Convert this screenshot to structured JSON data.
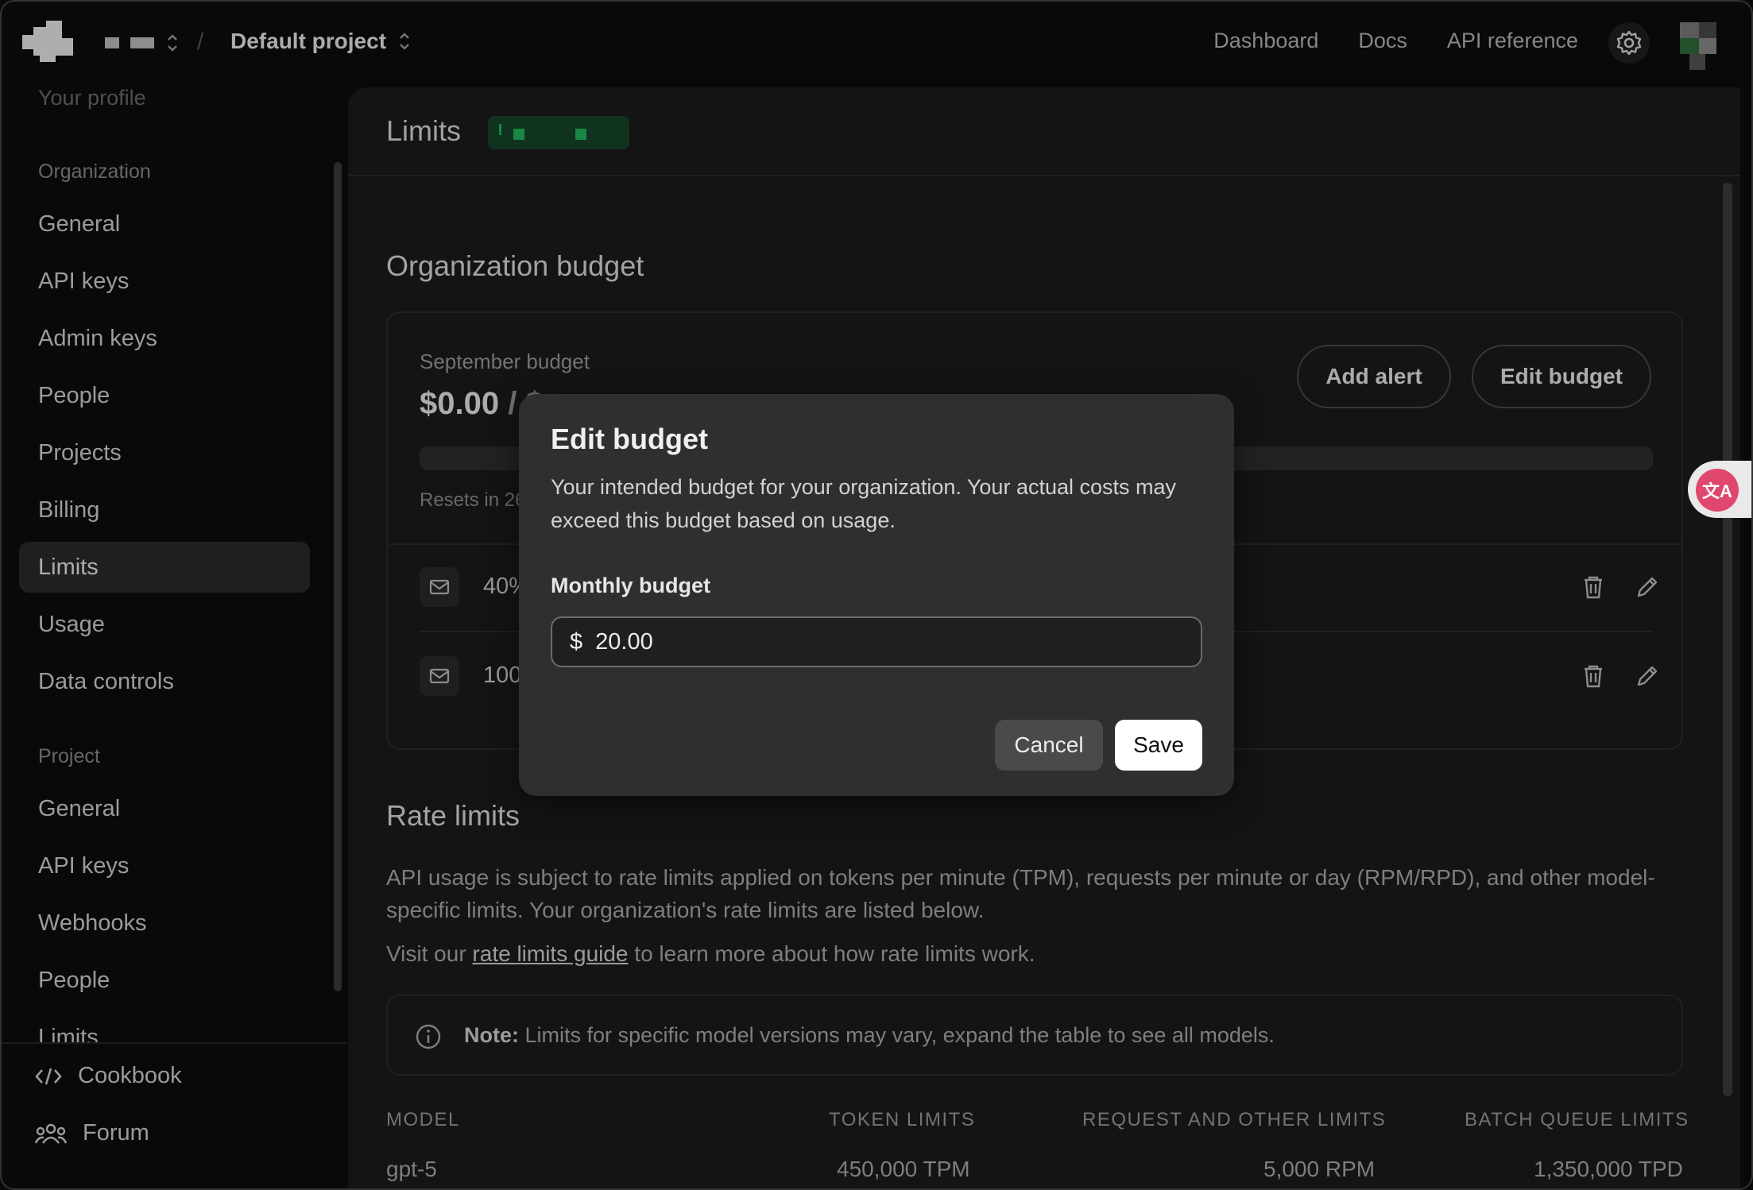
{
  "topbar": {
    "project_name": "Default project",
    "links": [
      "Dashboard",
      "Docs",
      "API reference"
    ]
  },
  "sidebar": {
    "faded_item": "Your profile",
    "org_section": "Organization",
    "org_items": [
      "General",
      "API keys",
      "Admin keys",
      "People",
      "Projects",
      "Billing",
      "Limits",
      "Usage",
      "Data controls"
    ],
    "project_section": "Project",
    "project_items": [
      "General",
      "API keys",
      "Webhooks",
      "People",
      "Limits"
    ],
    "footer": [
      "Cookbook",
      "Forum"
    ]
  },
  "main": {
    "title": "Limits",
    "org_budget_heading": "Organization budget",
    "budget_label": "September budget",
    "budget_amount": "$0.00",
    "budget_amount_suffix": " / $",
    "add_alert": "Add alert",
    "edit_budget": "Edit budget",
    "resets": "Resets in 26",
    "alerts": [
      "40%",
      "100%"
    ],
    "rate_limits_heading": "Rate limits",
    "rate_limits_desc": "API usage is subject to rate limits applied on tokens per minute (TPM), requests per minute or day (RPM/RPD), and other model-specific limits. Your organization's rate limits are listed below.",
    "visit_prefix": "Visit our ",
    "visit_link": "rate limits guide",
    "visit_suffix": " to learn more about how rate limits work.",
    "note_label": "Note:",
    "note_text": " Limits for specific model versions may vary, expand the table to see all models.",
    "table": {
      "headers": [
        "MODEL",
        "TOKEN LIMITS",
        "REQUEST AND OTHER LIMITS",
        "BATCH QUEUE LIMITS"
      ],
      "rows": [
        [
          "gpt-5",
          "450,000 TPM",
          "5,000 RPM",
          "1,350,000 TPD"
        ]
      ]
    }
  },
  "modal": {
    "title": "Edit budget",
    "description": "Your intended budget for your organization. Your actual costs may exceed this budget based on usage.",
    "field_label": "Monthly budget",
    "currency": "$",
    "value": "20.00",
    "cancel": "Cancel",
    "save": "Save"
  },
  "translate_widget": {
    "icon": "translate-icon"
  },
  "colors": {
    "accent_green": "#22b35a",
    "translate_pink": "#e0476e"
  }
}
